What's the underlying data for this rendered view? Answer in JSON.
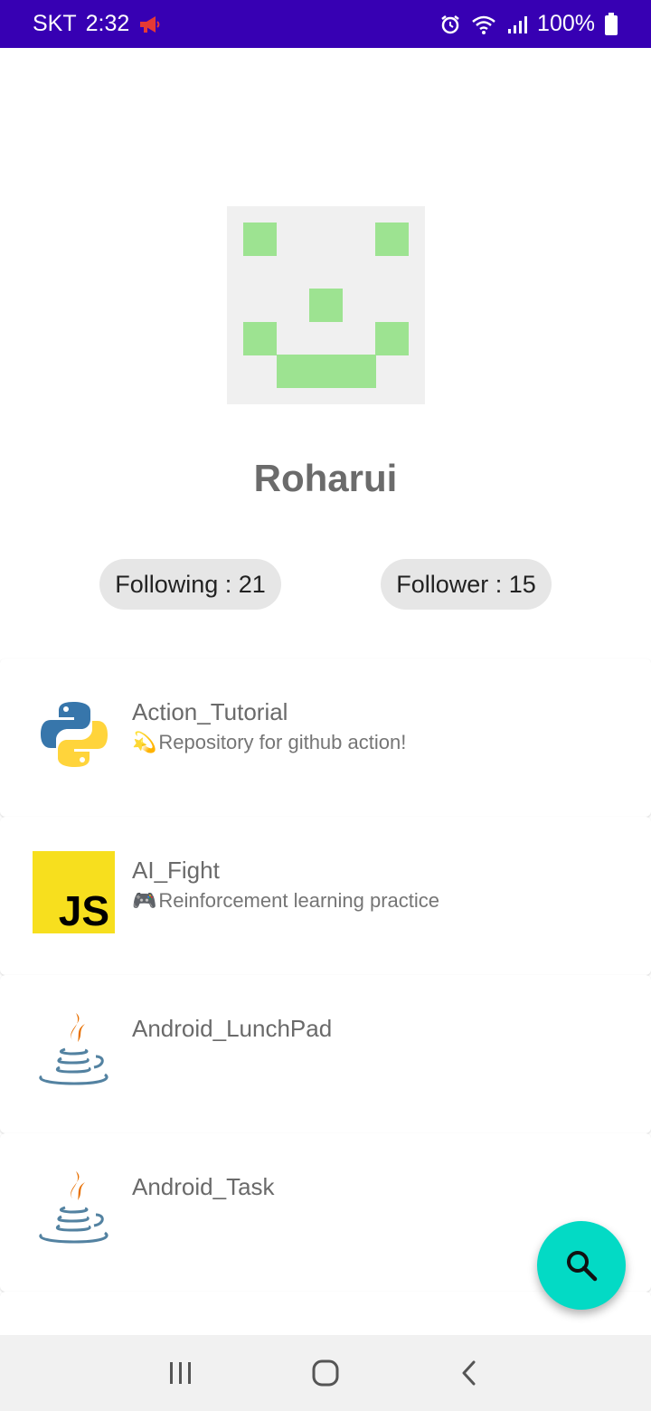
{
  "status_bar": {
    "carrier": "SKT",
    "time": "2:32",
    "battery": "100%",
    "icons": [
      "megaphone-icon",
      "alarm-icon",
      "wifi-icon",
      "signal-icon",
      "battery-icon"
    ]
  },
  "profile": {
    "username": "Roharui",
    "following_label": "Following : 21",
    "follower_label": "Follower : 15",
    "avatar_color": "#9de391"
  },
  "repos": [
    {
      "name": "Action_Tutorial",
      "emoji": "💫",
      "description": "Repository for github action!",
      "icon": "python-icon"
    },
    {
      "name": "AI_Fight",
      "emoji": "🎮",
      "description": "Reinforcement learning practice",
      "icon": "javascript-icon",
      "icon_text": "JS"
    },
    {
      "name": "Android_LunchPad",
      "emoji": "",
      "description": "",
      "icon": "java-icon"
    },
    {
      "name": "Android_Task",
      "emoji": "",
      "description": "",
      "icon": "java-icon"
    }
  ],
  "fab": {
    "icon": "search-icon",
    "color": "#03dac5"
  },
  "nav_bar": {
    "icons": [
      "recent-apps-icon",
      "home-icon",
      "back-icon"
    ]
  },
  "colors": {
    "status_bar": "#3700b3",
    "accent": "#03dac5"
  }
}
